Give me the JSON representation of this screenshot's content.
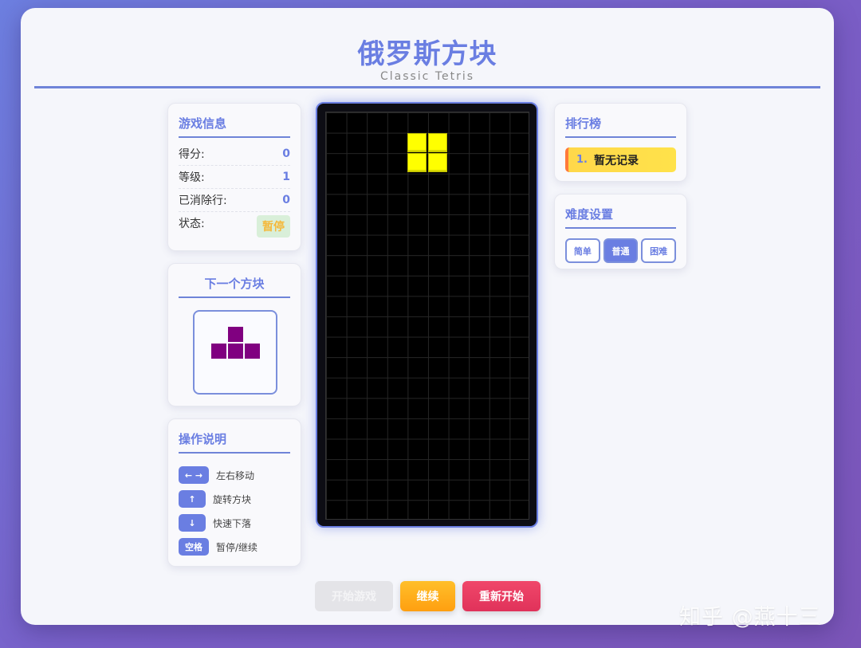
{
  "header": {
    "title": "俄罗斯方块",
    "subtitle": "Classic Tetris"
  },
  "game_info": {
    "title": "游戏信息",
    "score_label": "得分:",
    "score": "0",
    "level_label": "等级:",
    "level": "1",
    "lines_label": "已消除行:",
    "lines": "0",
    "status_label": "状态:",
    "status": "暂停"
  },
  "next_piece": {
    "title": "下一个方块",
    "piece": "T",
    "color": "#800080"
  },
  "controls": {
    "title": "操作说明",
    "items": [
      {
        "key": "← →",
        "desc": "左右移动"
      },
      {
        "key": "↑",
        "desc": "旋转方块"
      },
      {
        "key": "↓",
        "desc": "快速下落"
      },
      {
        "key": "空格",
        "desc": "暂停/继续"
      }
    ]
  },
  "board": {
    "columns": 10,
    "rows": 20,
    "active_piece": "O",
    "active_color": "#ffff00"
  },
  "leaderboard": {
    "title": "排行榜",
    "entries": [
      {
        "rank": "1.",
        "text": "暂无记录"
      }
    ]
  },
  "difficulty": {
    "title": "难度设置",
    "options": [
      "简单",
      "普通",
      "困难"
    ],
    "selected": "普通"
  },
  "actions": {
    "start": "开始游戏",
    "resume": "继续",
    "restart": "重新开始"
  },
  "watermark": "知乎 @燕十三"
}
